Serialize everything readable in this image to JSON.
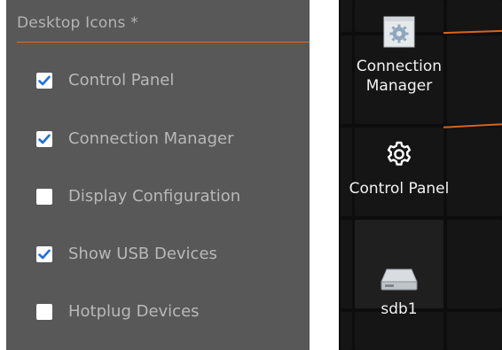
{
  "settings": {
    "section_title": "Desktop Icons *",
    "options": [
      {
        "label": "Control Panel",
        "checked": true
      },
      {
        "label": "Connection Manager",
        "checked": true
      },
      {
        "label": "Display Configuration",
        "checked": false
      },
      {
        "label": "Show USB Devices",
        "checked": true
      },
      {
        "label": "Hotplug Devices",
        "checked": false
      }
    ]
  },
  "desktop": {
    "icons": [
      {
        "label_line1": "Connection",
        "label_line2": "Manager",
        "icon": "connection-manager-icon"
      },
      {
        "label": "Control Panel",
        "icon": "gear-icon"
      },
      {
        "label": "sdb1",
        "icon": "drive-icon"
      }
    ]
  },
  "colors": {
    "panel_bg": "#585858",
    "accent": "#e26a1c",
    "checkbox_check": "#1e6fe0",
    "desktop_bg": "#0d0d0d"
  }
}
